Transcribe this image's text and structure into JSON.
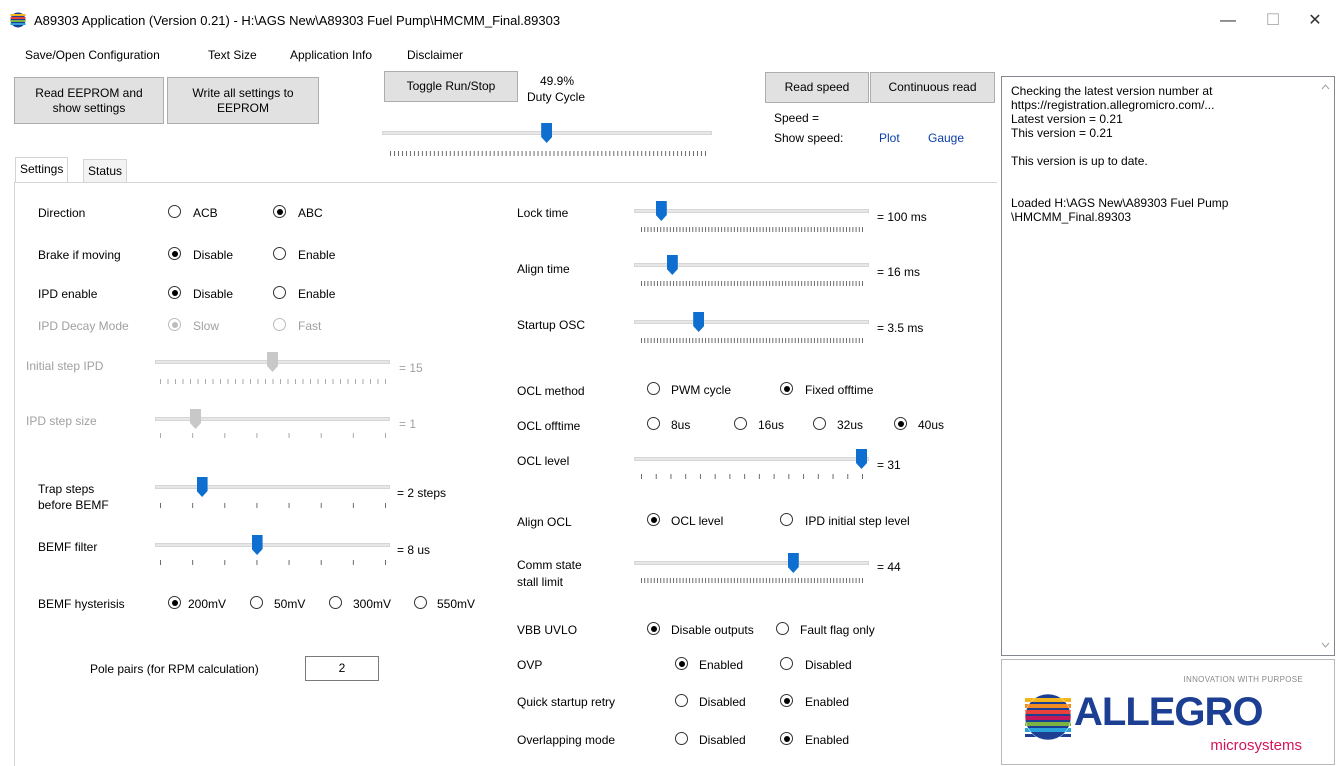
{
  "window": {
    "title": "A89303 Application (Version 0.21)  -  H:\\AGS New\\A89303 Fuel Pump\\HMCMM_Final.89303",
    "minimize": "—",
    "maximize": "☐",
    "close": "✕"
  },
  "menu": [
    "Save/Open Configuration",
    "Text Size",
    "Application Info",
    "Disclaimer"
  ],
  "toolbar": {
    "read_eeprom": "Read EEPROM and show settings",
    "read_eeprom_l1": "Read EEPROM and",
    "read_eeprom_l2": "show settings",
    "write_eeprom_l1": "Write all settings to",
    "write_eeprom_l2": "EEPROM",
    "toggle_run": "Toggle Run/Stop",
    "duty_value": "49.9%",
    "duty_label": "Duty Cycle",
    "duty_fraction": 0.499,
    "read_speed": "Read speed",
    "continuous_read": "Continuous read",
    "speed_label": "Speed =",
    "show_speed_label": "Show speed:",
    "plot_link": "Plot",
    "gauge_link": "Gauge"
  },
  "tabs": [
    "Settings",
    "Status"
  ],
  "settings_left": {
    "direction": {
      "label": "Direction",
      "opt1": "ACB",
      "opt2": "ABC",
      "selected": "ABC"
    },
    "brake": {
      "label": "Brake if moving",
      "opt1": "Disable",
      "opt2": "Enable",
      "selected": "Disable"
    },
    "ipd_enable": {
      "label": "IPD enable",
      "opt1": "Disable",
      "opt2": "Enable",
      "selected": "Disable"
    },
    "ipd_decay": {
      "label": "IPD Decay Mode",
      "opt1": "Slow",
      "opt2": "Fast",
      "selected": "Slow"
    },
    "initial_step": {
      "label": "Initial step IPD",
      "value": "= 15",
      "level": 0.5
    },
    "ipd_step_size": {
      "label": "IPD step size",
      "value": "= 1",
      "level": 0.15
    },
    "trap_steps": {
      "label1": "Trap steps",
      "label2": "before BEMF",
      "value": "= 2 steps",
      "level": 0.18
    },
    "bemf_filter": {
      "label": "BEMF filter",
      "value": "= 8 us",
      "level": 0.43
    },
    "bemf_hyst": {
      "label": "BEMF hysterisis",
      "opts": [
        "200mV",
        "50mV",
        "300mV",
        "550mV"
      ],
      "selected": "200mV"
    },
    "pole_pairs": {
      "label": "Pole pairs (for RPM calculation)",
      "value": "2"
    }
  },
  "settings_right": {
    "lock_time": {
      "label": "Lock time",
      "value": "= 100 ms",
      "level": 0.09
    },
    "align_time": {
      "label": "Align time",
      "value": "= 16 ms",
      "level": 0.14
    },
    "startup_osc": {
      "label": "Startup OSC",
      "value": "= 3.5 ms",
      "level": 0.26
    },
    "ocl_method": {
      "label": "OCL method",
      "opt1": "PWM cycle",
      "opt2": "Fixed offtime",
      "selected": "Fixed offtime"
    },
    "ocl_offtime": {
      "label": "OCL offtime",
      "opts": [
        "8us",
        "16us",
        "32us",
        "40us"
      ],
      "selected": "40us"
    },
    "ocl_level": {
      "label": "OCL level",
      "value": "= 31",
      "level": 1.0
    },
    "align_ocl": {
      "label": "Align OCL",
      "opt1": "OCL level",
      "opt2": "IPD initial step level",
      "selected": "OCL level"
    },
    "comm_state": {
      "label1": "Comm state",
      "label2": "stall limit",
      "value": "= 44",
      "level": 0.69
    },
    "vbb_uvlo": {
      "label": "VBB UVLO",
      "opt1": "Disable outputs",
      "opt2": "Fault flag only",
      "selected": "Disable outputs"
    },
    "ovp": {
      "label": "OVP",
      "opt1": "Enabled",
      "opt2": "Disabled",
      "selected": "Enabled"
    },
    "quick_startup": {
      "label": "Quick startup retry",
      "opt1": "Disabled",
      "opt2": "Enabled",
      "selected": "Enabled"
    },
    "overlapping": {
      "label": "Overlapping mode",
      "opt1": "Disabled",
      "opt2": "Enabled",
      "selected": "Enabled"
    }
  },
  "log": {
    "lines": [
      "Checking the latest version number at",
      "https://registration.allegromicro.com/...",
      "Latest version = 0.21",
      "This version = 0.21",
      "",
      "This version is up to date.",
      "",
      "Loaded H:\\AGS New\\A89303 Fuel Pump",
      "\\HMCMM_Final.89303"
    ]
  },
  "logo": {
    "tagline": "INNOVATION WITH PURPOSE",
    "brand": "ALLEGRO",
    "sub": "microsystems",
    "brand_color": "#1c3f94",
    "sub_color": "#d4145a"
  },
  "colors": {
    "accent": "#0e6fd0",
    "link": "#0b3ea8"
  }
}
